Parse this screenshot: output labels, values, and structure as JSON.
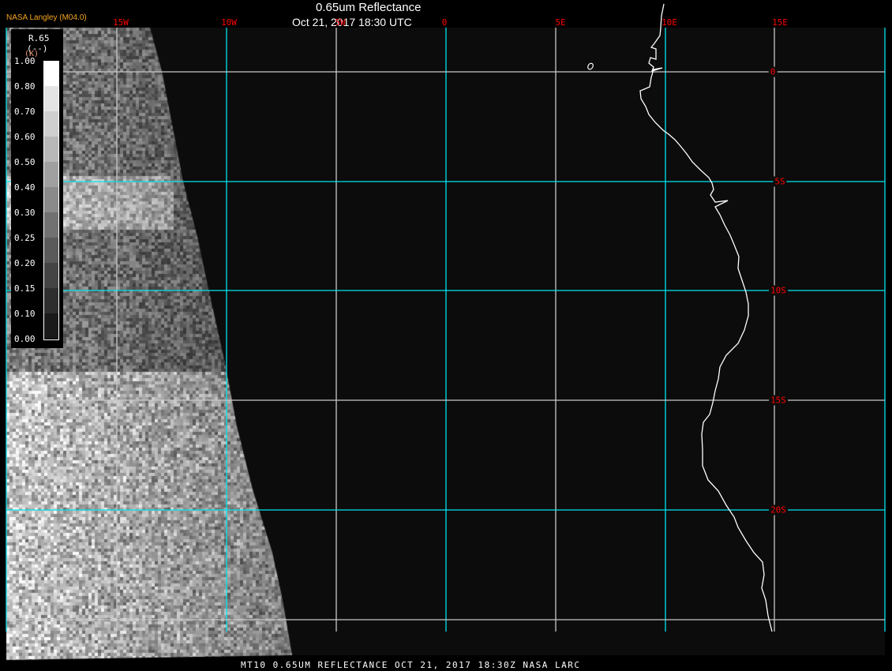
{
  "header": {
    "title": "0.65um Reflectance",
    "subtitle": "Oct 21, 2017 18:30 UTC",
    "brand": "NASA Langley (M04.0)"
  },
  "longitude_labels": [
    "15W",
    "10W",
    "5W",
    "0",
    "5E",
    "10E",
    "15E"
  ],
  "latitude_labels": [
    "0",
    "5S",
    "10S",
    "15S",
    "20S"
  ],
  "colorbar": {
    "title": "R.65",
    "units": "(--)",
    "unit_k": "(K)",
    "values": [
      "1.00",
      "0.80",
      "0.70",
      "0.60",
      "0.50",
      "0.40",
      "0.30",
      "0.25",
      "0.20",
      "0.15",
      "0.10",
      "0.00"
    ]
  },
  "footer": "MT10  0.65UM REFLECTANCE   OCT 21, 2017 18:30Z   NASA LARC",
  "colors": {
    "grid_major": "#00e5ee",
    "grid_minor": "#c8c8c8",
    "labels": "#ff0000",
    "coast": "#ffffff"
  }
}
